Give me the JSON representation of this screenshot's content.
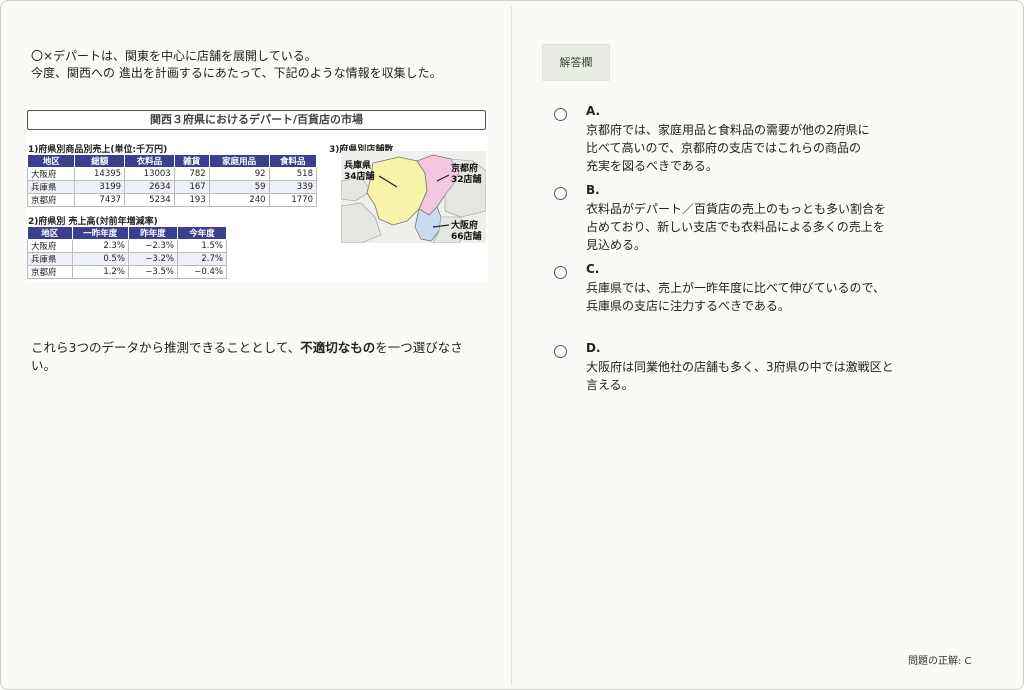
{
  "question": {
    "line1": "〇×デパートは、関東を中心に店舗を展開している。",
    "line2": "今度、関西への 進出を計画するにあたって、下記のような情報を収集した。",
    "sub_prefix": "これら3つのデータから推測できることとして、",
    "sub_bold": "不適切なもの",
    "sub_suffix": "を一つ選びなさい。"
  },
  "figure": {
    "title": "関西３府県におけるデパート/百貨店の市場",
    "section1": "1)府県別商品別売上(単位:千万円)",
    "section2": "2)府県別 売上高(対前年増減率)",
    "section3": "3)府県別店舗数",
    "table1": {
      "headers": [
        "地区",
        "総額",
        "衣料品",
        "雑貨",
        "家庭用品",
        "食料品"
      ],
      "rows": [
        [
          "大阪府",
          "14395",
          "13003",
          "782",
          "92",
          "518"
        ],
        [
          "兵庫県",
          "3199",
          "2634",
          "167",
          "59",
          "339"
        ],
        [
          "京都府",
          "7437",
          "5234",
          "193",
          "240",
          "1770"
        ]
      ]
    },
    "table2": {
      "headers": [
        "地区",
        "一昨年度",
        "昨年度",
        "今年度"
      ],
      "rows": [
        [
          "大阪府",
          "2.3%",
          "−2.3%",
          "1.5%"
        ],
        [
          "兵庫県",
          "0.5%",
          "−3.2%",
          "2.7%"
        ],
        [
          "京都府",
          "1.2%",
          "−3.5%",
          "−0.4%"
        ]
      ]
    },
    "map": {
      "hyogo_name": "兵庫県",
      "hyogo_count": "34店舗",
      "kyoto_name": "京都府",
      "kyoto_count": "32店舗",
      "osaka_name": "大阪府",
      "osaka_count": "66店舗",
      "colors": {
        "hyogo": "#f7f3a8",
        "kyoto": "#f3c7df",
        "osaka": "#c9dbef"
      }
    }
  },
  "answer": {
    "label": "解答欄",
    "options": [
      {
        "letter": "A.",
        "text": "京都府では、家庭用品と食料品の需要が他の2府県に\n比べて高いので、京都府の支店ではこれらの商品の\n充実を図るべきである。"
      },
      {
        "letter": "B.",
        "text": "衣料品がデパート／百貨店の売上のもっとも多い割合を\n占めており、新しい支店でも衣料品による多くの売上を\n見込める。"
      },
      {
        "letter": "C.",
        "text": "兵庫県では、売上が一昨年度に比べて伸びているので、\n兵庫県の支店に注力するべきである。"
      },
      {
        "letter": "D.",
        "text": "大阪府は同業他社の店舗も多く、3府県の中では激戦区と\n言える。"
      }
    ]
  },
  "footer": {
    "correct": "問題の正解: C"
  }
}
